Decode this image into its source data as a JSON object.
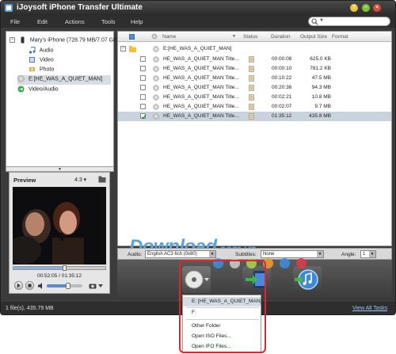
{
  "app": {
    "title": "iJoysoft iPhone Transfer Ultimate"
  },
  "menu": [
    "File",
    "Edit",
    "Actions",
    "Tools",
    "Help"
  ],
  "search": {
    "placeholder": ""
  },
  "tree": {
    "device": "Mary's iPhone (728.79 MB/7.07 GB)",
    "items": [
      "Audio",
      "Video",
      "Photo"
    ],
    "disc": "E:[HE_WAS_A_QUIET_MAN]",
    "video_audio": "Video/Audio"
  },
  "preview": {
    "title": "Preview",
    "ratio": "4:3",
    "time": "00:52:05 / 01:35:12",
    "progress": 0.55,
    "volume": 0.6
  },
  "list": {
    "columns": {
      "name": "Name",
      "status": "Status",
      "duration": "Duration",
      "size": "Output Size",
      "format": "Format"
    },
    "folder": "E:[HE_WAS_A_QUIET_MAN]",
    "rows": [
      {
        "name": "HE_WAS_A_QUIET_MAN Title...",
        "duration": "00:00:08",
        "size": "625.0 KB",
        "checked": false
      },
      {
        "name": "HE_WAS_A_QUIET_MAN Title...",
        "duration": "00:00:10",
        "size": "781.2 KB",
        "checked": false
      },
      {
        "name": "HE_WAS_A_QUIET_MAN Title...",
        "duration": "00:10:22",
        "size": "47.5 MB",
        "checked": false
      },
      {
        "name": "HE_WAS_A_QUIET_MAN Title...",
        "duration": "00:20:36",
        "size": "94.3 MB",
        "checked": false
      },
      {
        "name": "HE_WAS_A_QUIET_MAN Title...",
        "duration": "00:02:21",
        "size": "10.8 MB",
        "checked": false
      },
      {
        "name": "HE_WAS_A_QUIET_MAN Title...",
        "duration": "00:02:07",
        "size": "9.7 MB",
        "checked": false
      },
      {
        "name": "HE_WAS_A_QUIET_MAN Title...",
        "duration": "01:35:12",
        "size": "435.8 MB",
        "checked": true
      }
    ]
  },
  "watermark": {
    "main": "Download",
    "suffix": ".com.vn"
  },
  "bottom": {
    "audio_label": "Audio:",
    "audio_value": "English AC3 6ch (0x80)",
    "subtitles_label": "Subtitles:",
    "subtitles_value": "None",
    "angle_label": "Angle:",
    "angle_value": "1"
  },
  "dots": [
    "#3d8ee0",
    "#cfcfcf",
    "#a8d84a",
    "#f0a030",
    "#3d8ee0",
    "#e03a4a"
  ],
  "status": {
    "left": "1 file(s), 435.79 MB",
    "link": "View All Tasks"
  },
  "dropdown": {
    "items": [
      "E: [HE_WAS_A_QUIET_MAN]",
      "F:",
      "Other Folder",
      "Open ISO Files...",
      "Open IFO Files..."
    ]
  },
  "colors": {
    "accent_red": "#e0262b",
    "watermark": "#5aa2e2",
    "selection": "#c9d3de"
  }
}
